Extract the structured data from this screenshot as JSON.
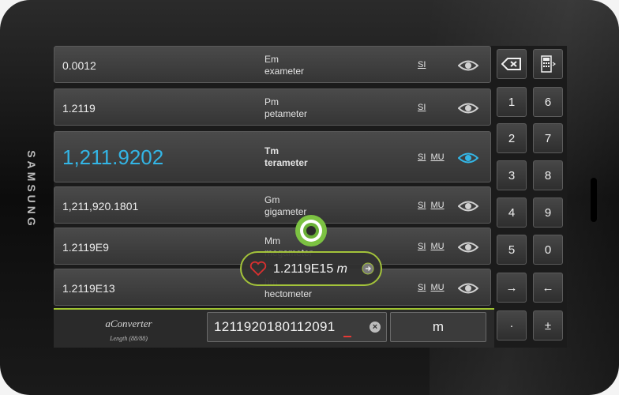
{
  "brand": "SAMSUNG",
  "rows": [
    {
      "value": "0.0012",
      "symbol": "Em",
      "name": "exameter",
      "systems": [
        "SI"
      ],
      "active": false
    },
    {
      "value": "1.2119",
      "symbol": "Pm",
      "name": "petameter",
      "systems": [
        "SI"
      ],
      "active": false
    },
    {
      "value": "1,211.9202",
      "symbol": "Tm",
      "name": "terameter",
      "systems": [
        "SI",
        "MU"
      ],
      "active": true
    },
    {
      "value": "1,211,920.1801",
      "symbol": "Gm",
      "name": "gigameter",
      "systems": [
        "SI",
        "MU"
      ],
      "active": false
    },
    {
      "value": "1.2119E9",
      "symbol": "Mm",
      "name": "megameter",
      "systems": [
        "SI",
        "MU"
      ],
      "active": false
    },
    {
      "value": "1.2119E13",
      "symbol": "hm",
      "name": "hectometer",
      "systems": [
        "SI",
        "MU"
      ],
      "active": false
    }
  ],
  "keypad": {
    "backspace_icon": "backspace-icon",
    "calc_icon": "calculator-icon",
    "keys": [
      "1",
      "6",
      "2",
      "7",
      "3",
      "8",
      "4",
      "9",
      "5",
      "0",
      "→",
      "←",
      "·",
      "±"
    ]
  },
  "logo": {
    "name": "aConverter",
    "sub": "Length (88/88)"
  },
  "input": {
    "value": "1211920180112091",
    "clear_icon": "clear-icon"
  },
  "unit_selector": "m",
  "popup": {
    "value": "1.2119E15",
    "unit": "m",
    "favorite_icon": "heart-icon",
    "go_icon": "arrow-circle-icon"
  },
  "colors": {
    "accent_blue": "#33b5e5",
    "accent_green": "#9fc331",
    "cursor_red": "#e53935"
  }
}
